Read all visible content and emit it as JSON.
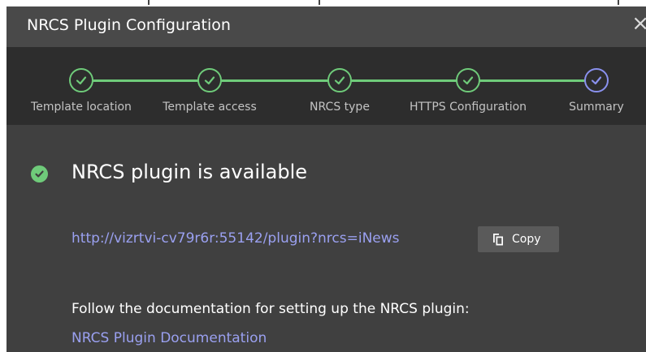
{
  "dialog": {
    "title": "NRCS Plugin Configuration",
    "close_glyph": "×"
  },
  "steps": [
    {
      "label": "Template location",
      "status": "done"
    },
    {
      "label": "Template access",
      "status": "done"
    },
    {
      "label": "NRCS type",
      "status": "done"
    },
    {
      "label": "HTTPS Configuration",
      "status": "done"
    },
    {
      "label": "Summary",
      "status": "current"
    }
  ],
  "summary": {
    "status_text": "NRCS plugin is available",
    "status_icon": "check-circle-icon",
    "plugin_url": "http://vizrtvi-cv79r6r:55142/plugin?nrcs=iNews",
    "copy_label": "Copy",
    "copy_icon": "copy-icon",
    "doc_intro": "Follow the documentation for setting up the NRCS plugin:",
    "doc_link": "NRCS Plugin Documentation"
  },
  "colors": {
    "dialog_bg": "#404040",
    "titlebar_bg": "#494949",
    "stepper_bg": "#2d2d2d",
    "success_green": "#6fcb7a",
    "current_step": "#8a91ee",
    "link": "#9aa0f0",
    "button_bg": "#5a5a5a"
  }
}
